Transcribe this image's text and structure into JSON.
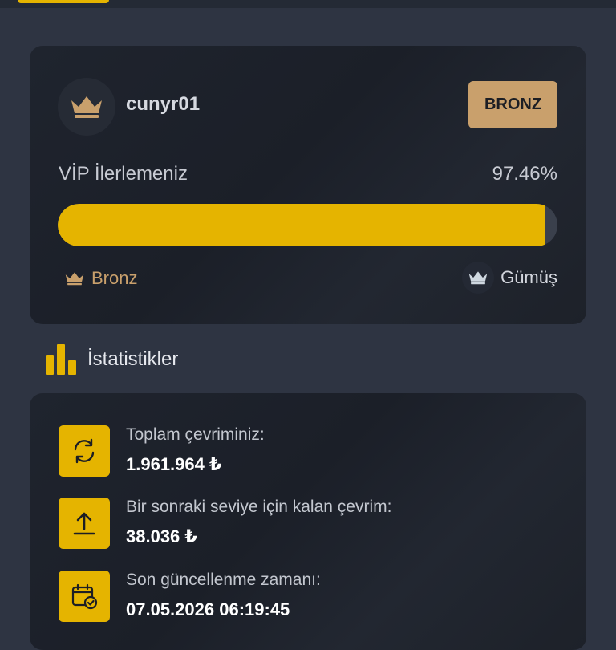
{
  "user": {
    "username": "cunyr01",
    "level_badge": "BRONZ"
  },
  "progress": {
    "label": "VİP İlerlemeniz",
    "percent_text": "97.46%",
    "percent": 97.46,
    "from_level": "Bronz",
    "to_level": "Gümüş"
  },
  "stats": {
    "title": "İstatistikler",
    "items": [
      {
        "icon": "refresh-icon",
        "label": "Toplam çevriminiz:",
        "value": "1.961.964 ₺"
      },
      {
        "icon": "upload-icon",
        "label": "Bir sonraki seviye için kalan çevrim:",
        "value": "38.036 ₺"
      },
      {
        "icon": "calendar-check-icon",
        "label": "Son güncellenme zamanı:",
        "value": "07.05.2026 06:19:45"
      }
    ]
  },
  "colors": {
    "accent": "#e5b400",
    "bronze": "#c9a06c",
    "silver": "#cfd8e0",
    "card": "#1e232c",
    "background": "#2e3442"
  }
}
